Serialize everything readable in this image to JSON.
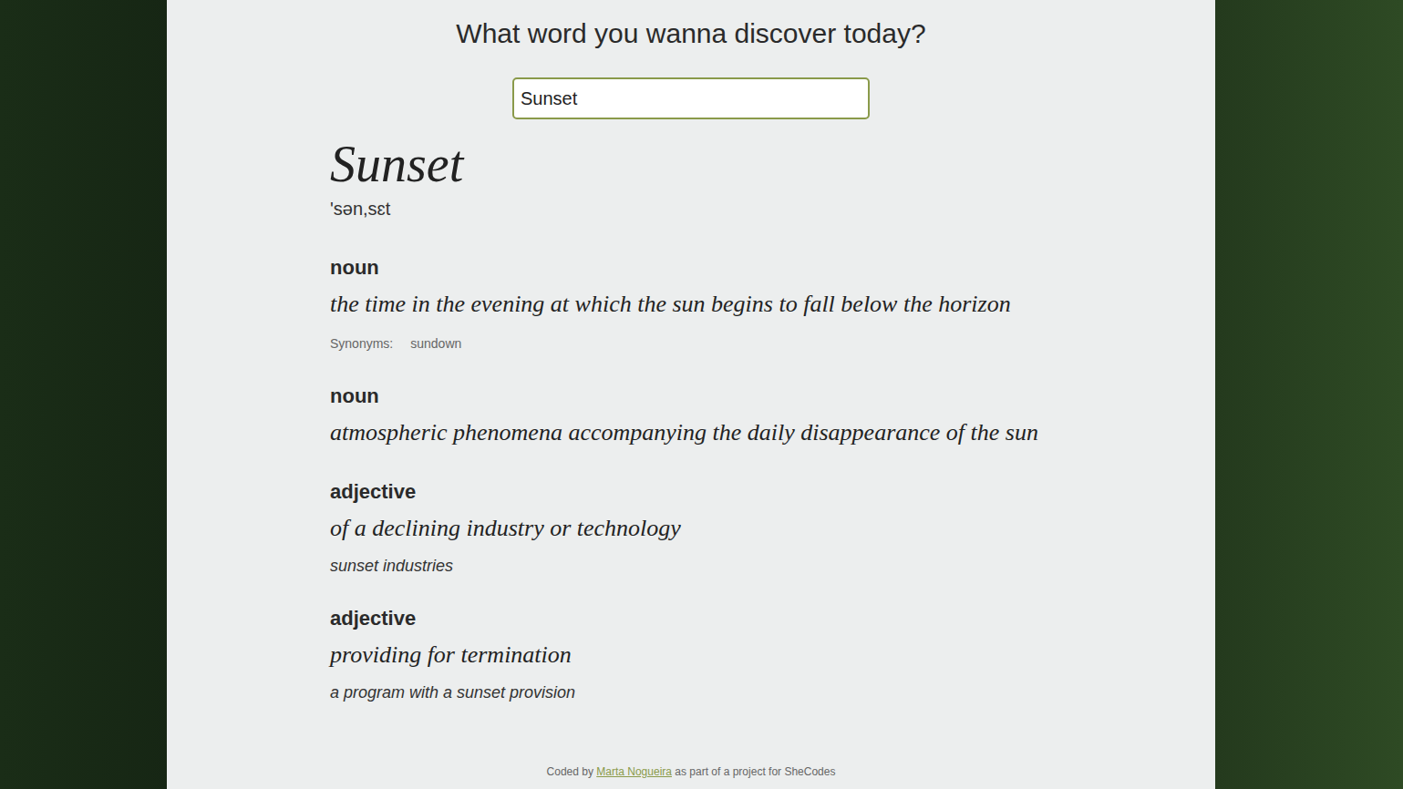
{
  "heading": "What word you wanna discover today?",
  "search": {
    "value": "Sunset"
  },
  "word": "Sunset",
  "phonetic": "'sən,sɛt",
  "meanings": [
    {
      "part_of_speech": "noun",
      "definition": "the time in the evening at which the sun begins to fall below the horizon",
      "synonyms_label": "Synonyms:",
      "synonyms": [
        "sundown"
      ]
    },
    {
      "part_of_speech": "noun",
      "definition": "atmospheric phenomena accompanying the daily disappearance of the sun"
    },
    {
      "part_of_speech": "adjective",
      "definition": "of a declining industry or technology",
      "example": "sunset industries"
    },
    {
      "part_of_speech": "adjective",
      "definition": "providing for termination",
      "example": "a program with a sunset provision"
    }
  ],
  "footer": {
    "before": "Coded by",
    "link": "Marta Nogueira",
    "after": "as part of a project for SheCodes"
  }
}
